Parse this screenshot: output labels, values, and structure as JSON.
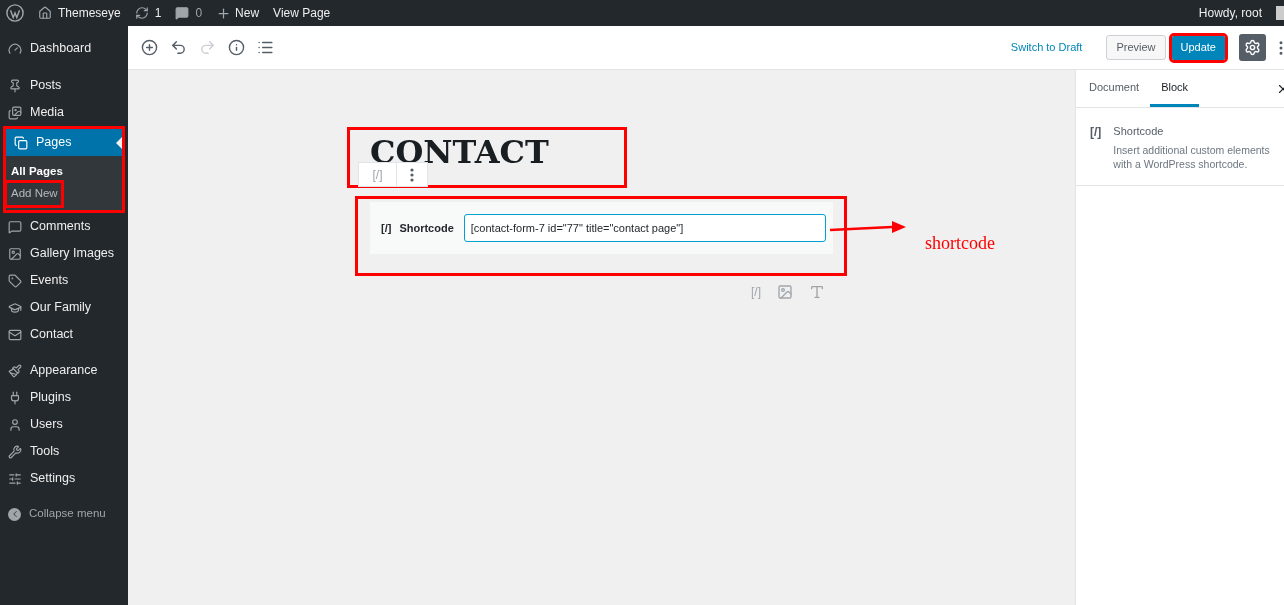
{
  "admin_bar": {
    "site": "Themeseye",
    "updates": "1",
    "comments": "0",
    "new": "New",
    "view": "View Page",
    "greeting": "Howdy, root"
  },
  "sidebar": {
    "groups": [
      [
        {
          "label": "Dashboard",
          "selected": false
        }
      ],
      [
        {
          "label": "Posts",
          "selected": false
        },
        {
          "label": "Media",
          "selected": false
        },
        {
          "label": "Pages",
          "selected": true,
          "highlighted": true,
          "children": [
            {
              "label": "All Pages",
              "selected": true
            },
            {
              "label": "Add New",
              "selected": false,
              "highlighted": true
            }
          ]
        },
        {
          "label": "Comments",
          "selected": false
        },
        {
          "label": "Gallery Images",
          "selected": false
        },
        {
          "label": "Events",
          "selected": false
        },
        {
          "label": "Our Family",
          "selected": false
        },
        {
          "label": "Contact",
          "selected": false
        }
      ],
      [
        {
          "label": "Appearance",
          "selected": false
        },
        {
          "label": "Plugins",
          "selected": false
        },
        {
          "label": "Users",
          "selected": false
        },
        {
          "label": "Tools",
          "selected": false
        },
        {
          "label": "Settings",
          "selected": false
        }
      ]
    ],
    "collapse": "Collapse menu"
  },
  "header": {
    "switch_draft": "Switch to Draft",
    "preview": "Preview",
    "update": {
      "label": "Update",
      "highlighted": true
    }
  },
  "editor": {
    "title": {
      "text": "CONTACT",
      "highlighted": true
    },
    "block_toolbar": {
      "icon": "[/]"
    },
    "shortcode_block": {
      "icon": "[/]",
      "label": "Shortcode",
      "value": "[contact-form-7 id=\"77\" title=\"contact page\"]",
      "highlighted": true
    },
    "inserter": {
      "shortcode": "[/]"
    }
  },
  "annotation": {
    "label": "shortcode"
  },
  "settings_panel": {
    "tabs": [
      {
        "label": "Document",
        "selected": false
      },
      {
        "label": "Block",
        "selected": true
      }
    ],
    "block": {
      "icon": "[/]",
      "title": "Shortcode",
      "description": "Insert additional custom elements with a WordPress shortcode."
    }
  }
}
